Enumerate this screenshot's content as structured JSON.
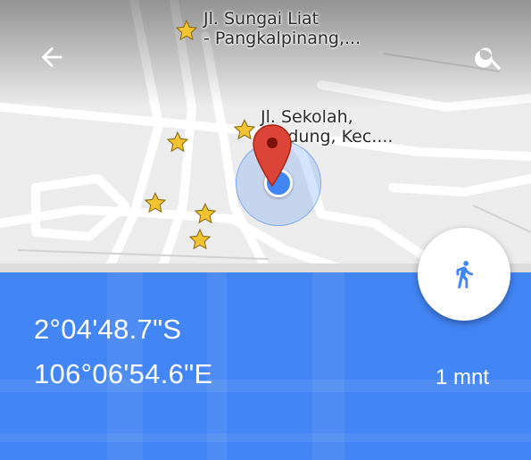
{
  "toolbar": {
    "back_icon": "arrow-back-icon",
    "search_icon": "search-icon"
  },
  "map": {
    "labels": [
      {
        "line1": "Jl. Sungai Liat",
        "line2": "- Pangkalpinang,..."
      },
      {
        "line1": "Jl. Sekolah,",
        "line2": "Bindung, Kec...."
      }
    ],
    "marker_icon": "star-icon",
    "pin_icon": "map-pin-icon",
    "accent_color": "#4285f4",
    "pin_color": "#db4437",
    "star_color": "#f4c430"
  },
  "location": {
    "latitude": "2°04'48.7\"S",
    "longitude": "106°06'54.6\"E",
    "travel_time": "1 mnt",
    "mode_icon": "walking-icon"
  }
}
